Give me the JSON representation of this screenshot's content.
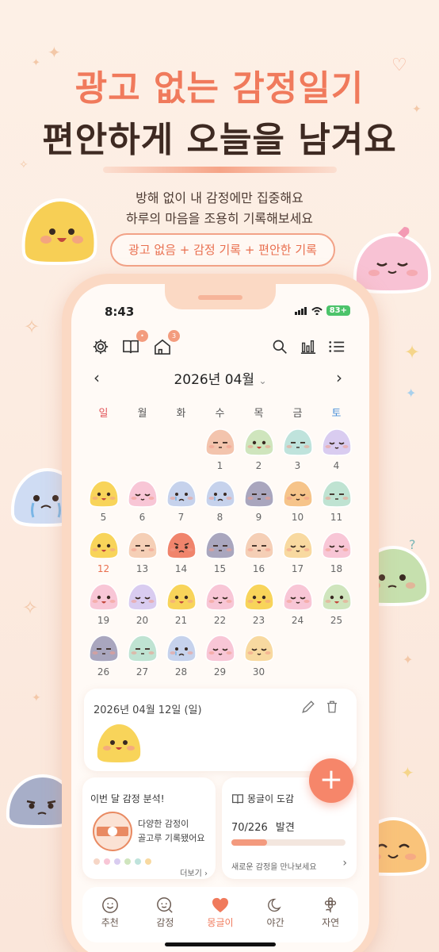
{
  "hero": {
    "title_line1": "광고 없는 감정일기",
    "title_line2": "편안하게 오늘을 남겨요",
    "subtitle_line1": "방해 없이 내 감정에만 집중해요",
    "subtitle_line2": "하루의 마음을 조용히 기록해보세요",
    "pill": "광고 없음 + 감정 기록 + 편안한 기록"
  },
  "status": {
    "time": "8:43",
    "battery": "83+"
  },
  "toolbar": {
    "settings_icon": "gear-icon",
    "diary_badge": "•",
    "shop_badge": "3"
  },
  "calendar": {
    "month_title": "2026년 04월",
    "weekdays": [
      "일",
      "월",
      "화",
      "수",
      "목",
      "금",
      "토"
    ],
    "weekday_colors": {
      "sun": "#e2555a",
      "sat": "#4a90d9"
    },
    "days": [
      {
        "d": "1",
        "c": "#f3c4ad",
        "m": "neutral"
      },
      {
        "d": "2",
        "c": "#cfe5bd",
        "m": "happy"
      },
      {
        "d": "3",
        "c": "#bfe3dc",
        "m": "neutral"
      },
      {
        "d": "4",
        "c": "#d9ccf0",
        "m": "calm"
      },
      {
        "d": "5",
        "c": "#f8d45a",
        "m": "happy"
      },
      {
        "d": "6",
        "c": "#f8c6d6",
        "m": "calm"
      },
      {
        "d": "7",
        "c": "#c6d2ec",
        "m": "sad"
      },
      {
        "d": "8",
        "c": "#c6d2ec",
        "m": "sad"
      },
      {
        "d": "9",
        "c": "#a9a6be",
        "m": "neutral"
      },
      {
        "d": "10",
        "c": "#f6c48a",
        "m": "calm"
      },
      {
        "d": "11",
        "c": "#bfe3d2",
        "m": "neutral"
      },
      {
        "d": "12",
        "c": "#f8d45a",
        "m": "happy"
      },
      {
        "d": "13",
        "c": "#f5cfb6",
        "m": "neutral"
      },
      {
        "d": "14",
        "c": "#f0846c",
        "m": "angry"
      },
      {
        "d": "15",
        "c": "#a9a6be",
        "m": "neutral"
      },
      {
        "d": "16",
        "c": "#f5cfb6",
        "m": "neutral"
      },
      {
        "d": "17",
        "c": "#f8d9a0",
        "m": "calm"
      },
      {
        "d": "18",
        "c": "#f8c6d6",
        "m": "calm"
      },
      {
        "d": "19",
        "c": "#f8c6d6",
        "m": "happy"
      },
      {
        "d": "20",
        "c": "#d9ccf0",
        "m": "calm"
      },
      {
        "d": "21",
        "c": "#f8d45a",
        "m": "happy"
      },
      {
        "d": "22",
        "c": "#f8c6d6",
        "m": "calm"
      },
      {
        "d": "23",
        "c": "#f8d45a",
        "m": "happy"
      },
      {
        "d": "24",
        "c": "#f8c6d6",
        "m": "calm"
      },
      {
        "d": "25",
        "c": "#cfe5bd",
        "m": "happy"
      },
      {
        "d": "26",
        "c": "#a9a6be",
        "m": "neutral"
      },
      {
        "d": "27",
        "c": "#bfe3d2",
        "m": "neutral"
      },
      {
        "d": "28",
        "c": "#c6d2ec",
        "m": "sad"
      },
      {
        "d": "29",
        "c": "#f8c6d6",
        "m": "calm"
      },
      {
        "d": "30",
        "c": "#f8d9a0",
        "m": "calm"
      }
    ],
    "highlight_day": "12",
    "highlight_color": "#e96f4f"
  },
  "detail": {
    "date": "2026년 04월 12일 (일)"
  },
  "analysis": {
    "title": "이번 달 감정 분석!",
    "text_line1": "다양한 감정이",
    "text_line2": "골고루 기록됐어요",
    "more": "더보기 ›"
  },
  "dex": {
    "title": "몽글이 도감",
    "count": "70/226",
    "found": "발견",
    "progress": 0.31,
    "cta": "새로운 감정을 만나보세요",
    "arrow": "›"
  },
  "fab": {
    "label": "+"
  },
  "bottom_nav": [
    {
      "label": "추천",
      "icon": "smile-icon"
    },
    {
      "label": "감정",
      "icon": "search-face-icon"
    },
    {
      "label": "몽글이",
      "icon": "heart-icon"
    },
    {
      "label": "야간",
      "icon": "moon-icon"
    },
    {
      "label": "자연",
      "icon": "flower-icon"
    }
  ],
  "colors": {
    "accent": "#f07a5c",
    "dark": "#3e2a22"
  }
}
